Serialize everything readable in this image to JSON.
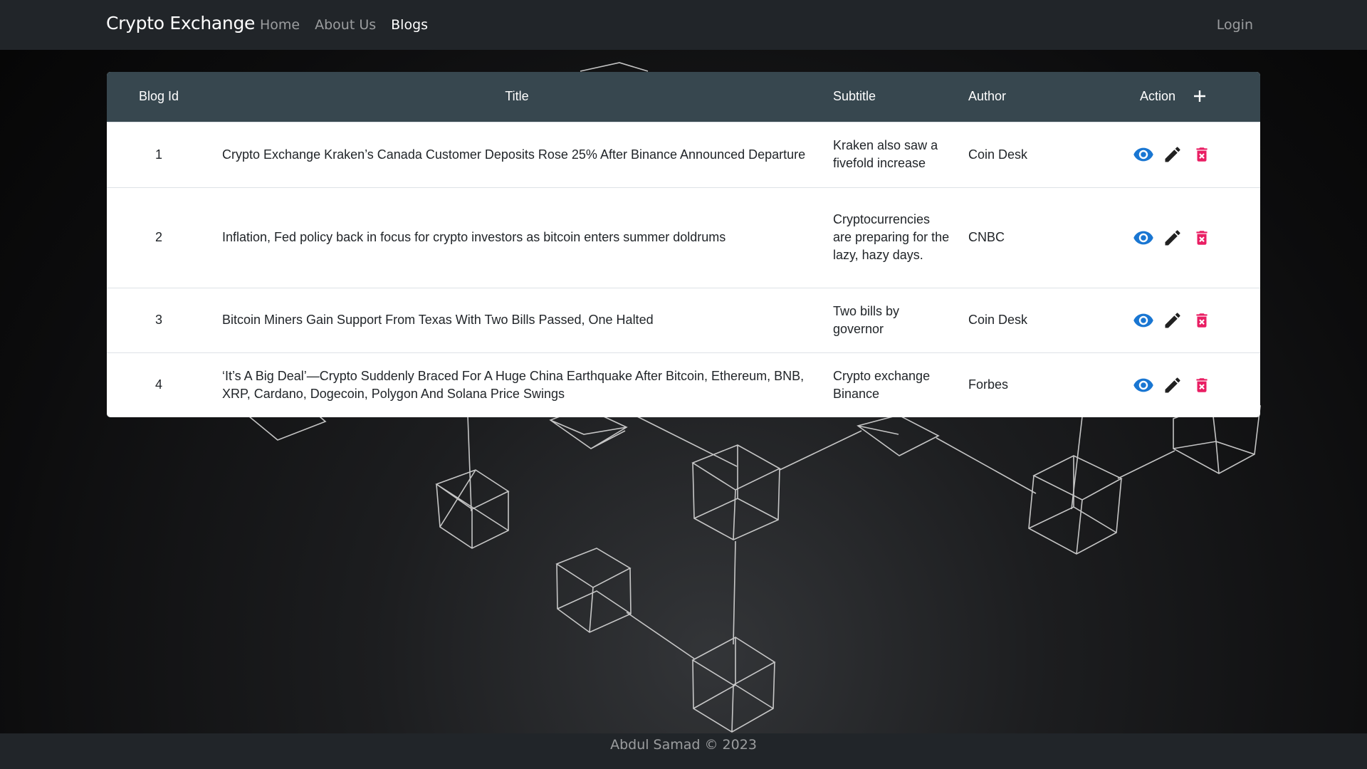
{
  "navbar": {
    "brand": "Crypto Exchange",
    "links": [
      {
        "label": "Home",
        "active": false
      },
      {
        "label": "About Us",
        "active": false
      },
      {
        "label": "Blogs",
        "active": true
      }
    ],
    "login_label": "Login"
  },
  "table": {
    "headers": {
      "id": "Blog Id",
      "title": "Title",
      "subtitle": "Subtitle",
      "author": "Author",
      "action": "Action"
    },
    "add_icon": "plus-icon",
    "rows": [
      {
        "id": "1",
        "title": "Crypto Exchange Kraken’s Canada Customer Deposits Rose 25% After Binance Announced Departure",
        "subtitle": "Kraken also saw a fivefold increase",
        "author": "Coin Desk"
      },
      {
        "id": "2",
        "title": "Inflation, Fed policy back in focus for crypto investors as bitcoin enters summer doldrums",
        "subtitle": "Cryptocurrencies are preparing for the lazy, hazy days.",
        "author": "CNBC"
      },
      {
        "id": "3",
        "title": "Bitcoin Miners Gain Support From Texas With Two Bills Passed, One Halted",
        "subtitle": "Two bills by governor",
        "author": "Coin Desk"
      },
      {
        "id": "4",
        "title": "‘It’s A Big Deal’—Crypto Suddenly Braced For A Huge China Earthquake After Bitcoin, Ethereum, BNB, XRP, Cardano, Dogecoin, Polygon And Solana Price Swings",
        "subtitle": "Crypto exchange Binance",
        "author": "Forbes"
      }
    ],
    "action_icons": [
      "eye-icon",
      "pencil-icon",
      "trash-icon"
    ]
  },
  "footer": {
    "text": "Abdul Samad © 2023"
  },
  "colors": {
    "navbar_bg": "#212529",
    "table_header_bg": "#37474f",
    "view_icon": "#1976d2",
    "edit_icon": "#212121",
    "delete_icon": "#e91e63"
  }
}
